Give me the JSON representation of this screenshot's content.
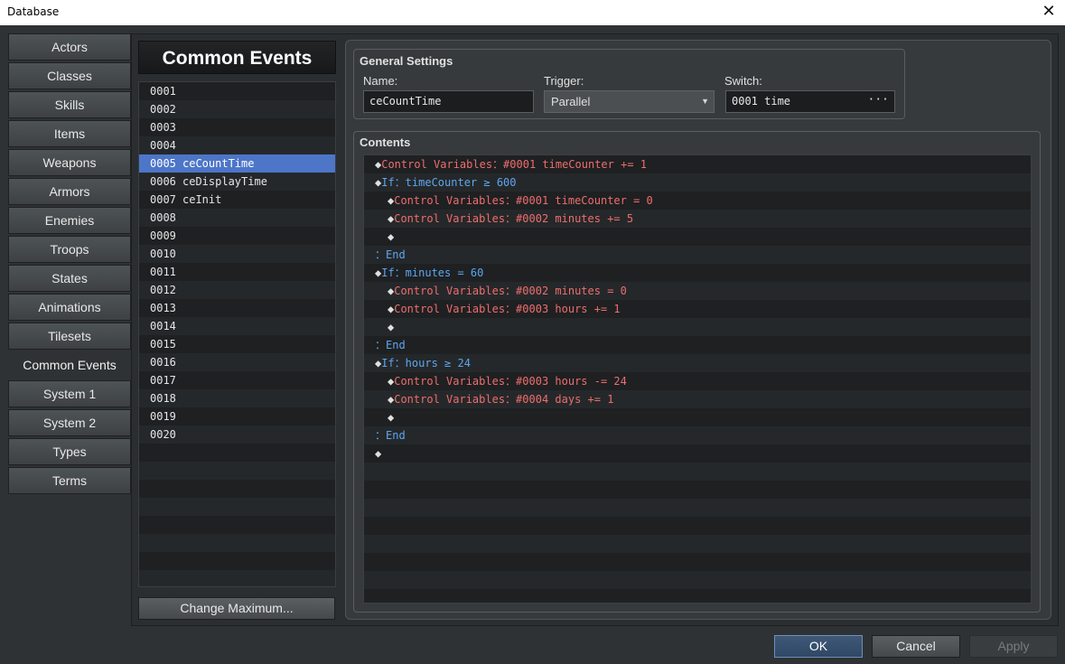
{
  "window": {
    "title": "Database",
    "close_glyph": "✕"
  },
  "tabs": [
    {
      "label": "Actors",
      "active": false
    },
    {
      "label": "Classes",
      "active": false
    },
    {
      "label": "Skills",
      "active": false
    },
    {
      "label": "Items",
      "active": false
    },
    {
      "label": "Weapons",
      "active": false
    },
    {
      "label": "Armors",
      "active": false
    },
    {
      "label": "Enemies",
      "active": false
    },
    {
      "label": "Troops",
      "active": false
    },
    {
      "label": "States",
      "active": false
    },
    {
      "label": "Animations",
      "active": false
    },
    {
      "label": "Tilesets",
      "active": false
    },
    {
      "label": "Common Events",
      "active": true
    },
    {
      "label": "System 1",
      "active": false
    },
    {
      "label": "System 2",
      "active": false
    },
    {
      "label": "Types",
      "active": false
    },
    {
      "label": "Terms",
      "active": false
    }
  ],
  "common_events": {
    "header": "Common Events",
    "items": [
      {
        "num": "0001",
        "name": ""
      },
      {
        "num": "0002",
        "name": ""
      },
      {
        "num": "0003",
        "name": ""
      },
      {
        "num": "0004",
        "name": ""
      },
      {
        "num": "0005",
        "name": "ceCountTime",
        "selected": true
      },
      {
        "num": "0006",
        "name": "ceDisplayTime"
      },
      {
        "num": "0007",
        "name": "ceInit"
      },
      {
        "num": "0008",
        "name": ""
      },
      {
        "num": "0009",
        "name": ""
      },
      {
        "num": "0010",
        "name": ""
      },
      {
        "num": "0011",
        "name": ""
      },
      {
        "num": "0012",
        "name": ""
      },
      {
        "num": "0013",
        "name": ""
      },
      {
        "num": "0014",
        "name": ""
      },
      {
        "num": "0015",
        "name": ""
      },
      {
        "num": "0016",
        "name": ""
      },
      {
        "num": "0017",
        "name": ""
      },
      {
        "num": "0018",
        "name": ""
      },
      {
        "num": "0019",
        "name": ""
      },
      {
        "num": "0020",
        "name": ""
      }
    ],
    "change_max_label": "Change Maximum..."
  },
  "general_settings": {
    "title": "General Settings",
    "name_label": "Name:",
    "name_value": "ceCountTime",
    "trigger_label": "Trigger:",
    "trigger_value": "Parallel",
    "switch_label": "Switch:",
    "switch_value": "0001 time",
    "switch_button": "···"
  },
  "contents": {
    "title": "Contents",
    "commands": [
      {
        "indent": 0,
        "text": "Control Variables：#0001 timeCounter += 1",
        "color": "red",
        "diamond": true
      },
      {
        "indent": 0,
        "text": "If：timeCounter ≥ 600",
        "color": "blue",
        "diamond": true
      },
      {
        "indent": 1,
        "text": "Control Variables：#0001 timeCounter = 0",
        "color": "red",
        "diamond": true
      },
      {
        "indent": 1,
        "text": "Control Variables：#0002 minutes += 5",
        "color": "red",
        "diamond": true
      },
      {
        "indent": 1,
        "text": "",
        "color": "white",
        "diamond": true
      },
      {
        "indent": 0,
        "text": "：End",
        "color": "blue",
        "diamond": false
      },
      {
        "indent": 0,
        "text": "If：minutes = 60",
        "color": "blue",
        "diamond": true
      },
      {
        "indent": 1,
        "text": "Control Variables：#0002 minutes = 0",
        "color": "red",
        "diamond": true
      },
      {
        "indent": 1,
        "text": "Control Variables：#0003 hours += 1",
        "color": "red",
        "diamond": true
      },
      {
        "indent": 1,
        "text": "",
        "color": "white",
        "diamond": true
      },
      {
        "indent": 0,
        "text": "：End",
        "color": "blue",
        "diamond": false
      },
      {
        "indent": 0,
        "text": "If：hours ≥ 24",
        "color": "blue",
        "diamond": true
      },
      {
        "indent": 1,
        "text": "Control Variables：#0003 hours -= 24",
        "color": "red",
        "diamond": true
      },
      {
        "indent": 1,
        "text": "Control Variables：#0004 days += 1",
        "color": "red",
        "diamond": true
      },
      {
        "indent": 1,
        "text": "",
        "color": "white",
        "diamond": true
      },
      {
        "indent": 0,
        "text": "：End",
        "color": "blue",
        "diamond": false
      },
      {
        "indent": 0,
        "text": "",
        "color": "white",
        "diamond": true
      }
    ],
    "total_rows": 25
  },
  "buttons": {
    "ok": "OK",
    "cancel": "Cancel",
    "apply": "Apply"
  },
  "colors": {
    "selection": "#4d76c9",
    "command_red": "#ef6d6d",
    "command_blue": "#5ea6f0"
  }
}
